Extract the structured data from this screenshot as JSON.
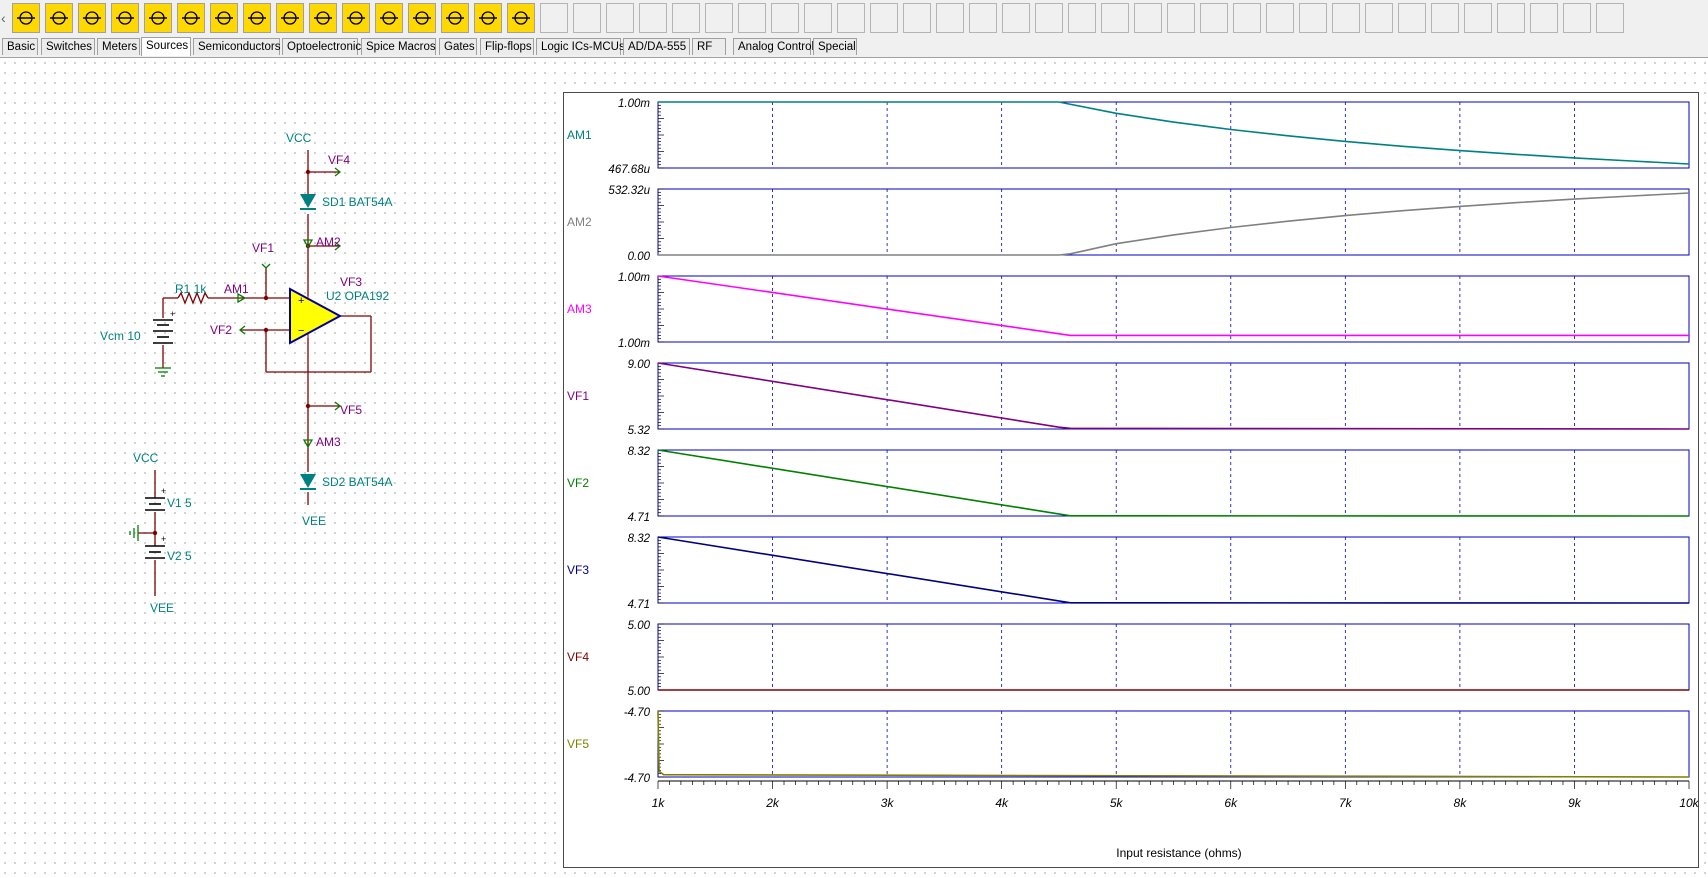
{
  "toolbar": {
    "icons": [
      "power-source-icon",
      "battery-icon",
      "ammeter-icon",
      "voltmeter-icon",
      "current-source-icon",
      "switch-icon",
      "resistor-icon",
      "resistor-icon",
      "resistor-icon",
      "resistor-icon",
      "voltage-pin-icon",
      "pulse-source-icon",
      "pulse-source-icon",
      "ic-icon",
      "ic-icon",
      "crystal-icon"
    ]
  },
  "tabs": [
    {
      "label": "Basic"
    },
    {
      "label": "Switches"
    },
    {
      "label": "Meters"
    },
    {
      "label": "Sources"
    },
    {
      "label": "Semiconductors"
    },
    {
      "label": "Optoelectronic"
    },
    {
      "label": "Spice Macros"
    },
    {
      "label": "Gates"
    },
    {
      "label": "Flip-flops"
    },
    {
      "label": "Logic ICs-MCUs"
    },
    {
      "label": "AD/DA-555"
    },
    {
      "label": "RF"
    },
    {
      "label": "Analog Control"
    },
    {
      "label": "Special"
    }
  ],
  "active_tab": "Sources",
  "schematic": {
    "vcc_top": "VCC",
    "vf4": "VF4",
    "sd1": "SD1 BAT54A",
    "am2": "AM2",
    "vf1": "VF1",
    "vf3": "VF3",
    "r1": "R1 1k",
    "am1": "AM1",
    "u2": "U2 OPA192",
    "vcm": "Vcm 10",
    "vf2": "VF2",
    "vf5": "VF5",
    "am3": "AM3",
    "sd2": "SD2 BAT54A",
    "vee_mid": "VEE",
    "vcc_bottom": "VCC",
    "v1": "V1 5",
    "v2": "V2 5",
    "vee_bottom": "VEE",
    "colors": {
      "wire": "#800000",
      "label": "#008080",
      "probe": "#800080",
      "opamp_fill": "#ffff00"
    }
  },
  "chart_data": {
    "type": "line",
    "xlabel": "Input resistance (ohms)",
    "x_ticks": [
      "1k",
      "2k",
      "3k",
      "4k",
      "5k",
      "6k",
      "7k",
      "8k",
      "9k",
      "10k"
    ],
    "xlim": [
      1000,
      10000
    ],
    "grid": true,
    "panels": [
      {
        "name": "AM1",
        "color": "#008080",
        "ytop": "1.00m",
        "ybottom": "467.68u",
        "ylim": [
          0.00046768,
          0.001
        ],
        "x": [
          1000,
          4500,
          5000,
          5500,
          6000,
          6500,
          7000,
          7500,
          8000,
          8500,
          9000,
          9500,
          10000
        ],
        "values": [
          0.001,
          0.001,
          0.000909,
          0.000838,
          0.000778,
          0.000727,
          0.000682,
          0.000643,
          0.000608,
          0.000577,
          0.000549,
          0.000524,
          0.0005
        ]
      },
      {
        "name": "AM2",
        "color": "#808080",
        "ytop": "532.32u",
        "ybottom": "0.00",
        "ylim": [
          0,
          0.00053232
        ],
        "x": [
          1000,
          4500,
          4600,
          5000,
          5500,
          6000,
          6500,
          7000,
          7500,
          8000,
          8500,
          9000,
          9500,
          10000
        ],
        "values": [
          0,
          0,
          1e-05,
          9.1e-05,
          0.000162,
          0.000222,
          0.000273,
          0.000318,
          0.000357,
          0.000392,
          0.000423,
          0.000451,
          0.000476,
          0.0005
        ]
      },
      {
        "name": "AM3",
        "color": "#ff00ff",
        "ytop": "1.00m",
        "ybottom": "1.00m",
        "ylim": [
          0.000999,
          0.001
        ],
        "x": [
          1000,
          4600,
          10000
        ],
        "values": [
          0.001,
          0.0009991,
          0.0009991
        ]
      },
      {
        "name": "VF1",
        "color": "#800080",
        "ytop": "9.00",
        "ybottom": "5.32",
        "ylim": [
          5.32,
          9.0
        ],
        "x": [
          1000,
          4500,
          4600,
          10000
        ],
        "values": [
          9.0,
          5.42,
          5.36,
          5.32
        ]
      },
      {
        "name": "VF2",
        "color": "#008000",
        "ytop": "8.32",
        "ybottom": "4.71",
        "ylim": [
          4.71,
          8.32
        ],
        "x": [
          1000,
          4600,
          10000
        ],
        "values": [
          8.32,
          4.72,
          4.71
        ]
      },
      {
        "name": "VF3",
        "color": "#000080",
        "ytop": "8.32",
        "ybottom": "4.71",
        "ylim": [
          4.71,
          8.32
        ],
        "x": [
          1000,
          4600,
          10000
        ],
        "values": [
          8.32,
          4.72,
          4.71
        ]
      },
      {
        "name": "VF4",
        "color": "#800000",
        "ytop": "5.00",
        "ybottom": "5.00",
        "ylim": [
          4.99,
          5.01
        ],
        "x": [
          1000,
          10000
        ],
        "values": [
          4.99,
          4.99
        ]
      },
      {
        "name": "VF5",
        "color": "#808000",
        "ytop": "-4.70",
        "ybottom": "-4.70",
        "ylim": [
          -4.71,
          -4.69
        ],
        "x": [
          1000,
          1010,
          1050,
          10000
        ],
        "values": [
          -4.69,
          -4.7083,
          -4.7093,
          -4.71
        ]
      }
    ]
  }
}
